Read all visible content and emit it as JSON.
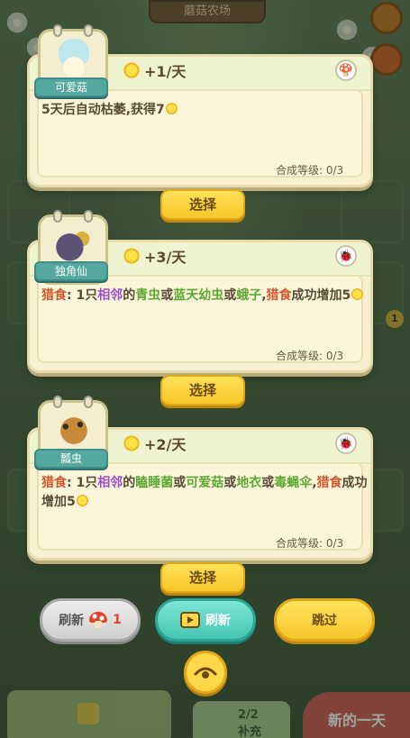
{
  "background": {
    "board_title": "蘑菇农场",
    "badge_number": "1",
    "water_count": "2/2",
    "water_label": "补充",
    "next_day_label": "新的一天"
  },
  "cards": [
    {
      "name": "可爱菇",
      "yield": "+1/天",
      "type_icon": "mushroom-icon",
      "description": "5天后自动枯萎,获得7",
      "level_label": "合成等级: 0/3",
      "select_label": "选择"
    },
    {
      "name": "独角仙",
      "yield": "+3/天",
      "type_icon": "bug-icon",
      "desc": {
        "hunt": "猎食",
        "p1": ":  1只",
        "adj": "相邻",
        "p2": "的",
        "prey1": "青虫",
        "or1": "或",
        "prey2": "蓝天幼虫",
        "or2": "或",
        "prey3": "蛾子",
        "comma": ",",
        "hunt2": "猎食",
        "p3": "成功增加5"
      },
      "level_label": "合成等级: 0/3",
      "select_label": "选择"
    },
    {
      "name": "瓢虫",
      "yield": "+2/天",
      "type_icon": "bug-icon",
      "desc": {
        "hunt": "猎食",
        "p1": ":  1只",
        "adj": "相邻",
        "p2": "的",
        "prey1": "瞌睡菌",
        "or1": "或",
        "prey2": "可爱菇",
        "or2": "或",
        "prey3": "地衣",
        "or3": "或",
        "prey4": "毒蝇伞",
        "comma": ",",
        "hunt2": "猎食",
        "p3": "成功增加5"
      },
      "level_label": "合成等级: 0/3",
      "select_label": "选择"
    }
  ],
  "controls": {
    "refresh_paid_label": "刷新",
    "refresh_paid_cost": "1",
    "refresh_ad_label": "刷新",
    "skip_label": "跳过"
  },
  "colors": {
    "hunt": "#d8542b",
    "adjacent": "#9b52c9",
    "prey": "#5ba832",
    "select_button": "#f8c72a",
    "ad_button": "#45c6b2"
  }
}
